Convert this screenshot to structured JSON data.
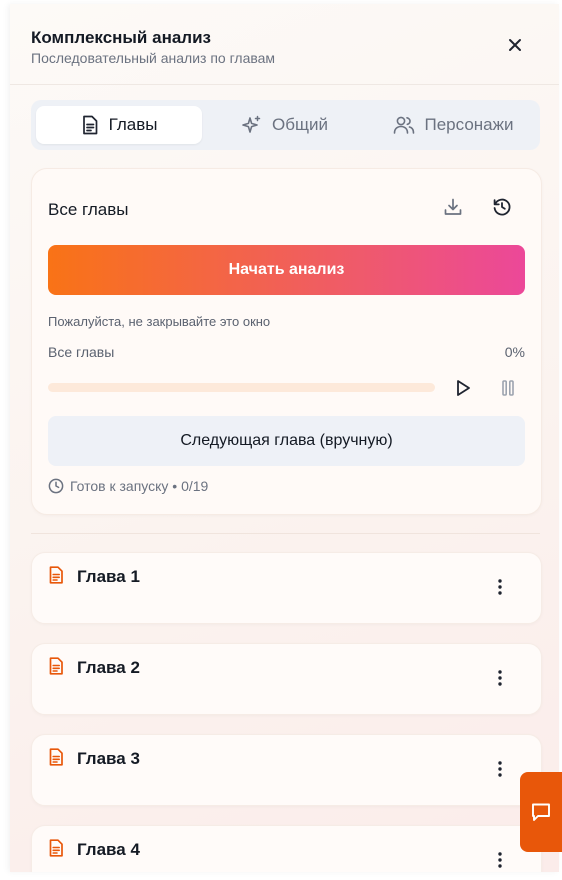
{
  "header": {
    "title": "Комплексный анализ",
    "subtitle": "Последовательный анализ по главам"
  },
  "tabs": [
    {
      "label": "Главы",
      "icon": "document-icon",
      "active": true
    },
    {
      "label": "Общий",
      "icon": "sparkles-icon",
      "active": false
    },
    {
      "label": "Персонажи",
      "icon": "users-icon",
      "active": false
    }
  ],
  "analysis": {
    "title": "Все главы",
    "start_label": "Начать анализ",
    "warning": "Пожалуйста, не закрывайте это окно",
    "progress_label": "Все главы",
    "progress_percent": "0%",
    "progress_value": 0,
    "next_label": "Следующая глава (вручную)",
    "status": "Готов к запуску • 0/19"
  },
  "chapters": [
    {
      "title": "Глава 1"
    },
    {
      "title": "Глава 2"
    },
    {
      "title": "Глава 3"
    },
    {
      "title": "Глава 4"
    }
  ],
  "colors": {
    "accent": "#f97316",
    "gradient_end": "#ec4899",
    "chat_fab": "#e8570a"
  }
}
